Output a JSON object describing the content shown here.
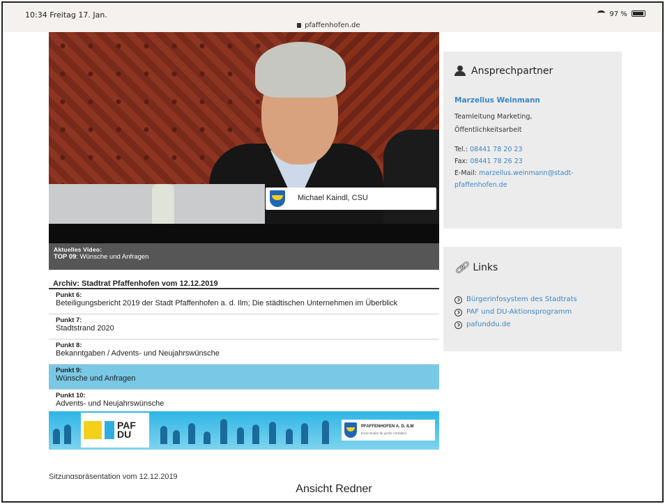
{
  "status_bar": {
    "time": "10:34",
    "date": "Freitag 17. Jan.",
    "url": "pfaffenhofen.de",
    "battery": "97 %"
  },
  "video": {
    "speaker": "Michael Kaindl, CSU",
    "current_label": "Aktuelles Video:",
    "current_top_prefix": "TOP 09",
    "current_top_title": ": Wünsche und Anfragen"
  },
  "archive": {
    "title": "Archiv: Stadtrat Pfaffenhofen vom 12.12.2019",
    "items": [
      {
        "point": "Punkt 6:",
        "text": "Beteiligungsbericht 2019 der Stadt Pfaffenhofen a. d. Ilm; Die städtischen Unternehmen im Überblick",
        "active": false
      },
      {
        "point": "Punkt 7:",
        "text": "Stadtstrand 2020",
        "active": false
      },
      {
        "point": "Punkt 8:",
        "text": "Bekanntgaben / Advents- und Neujahrswünsche",
        "active": false
      },
      {
        "point": "Punkt 9:",
        "text": "Wünsche und Anfragen",
        "active": true
      },
      {
        "point": "Punkt 10:",
        "text": "Advents- und Neujahrswünsche",
        "active": false
      }
    ]
  },
  "banner": {
    "paf_text_1": "PAF",
    "paf_text_2": "DU",
    "logo_title": "PFAFFENHOFEN A. D. ILM",
    "logo_sub": "Eurer Boden für große Vorhaben"
  },
  "cutoff_text": "Sitzungspräsentation vom 12.12.2019",
  "contact": {
    "heading": "Ansprechpartner",
    "name": "Marzellus Weinmann",
    "role_line1": "Teamleitung Marketing,",
    "role_line2": "Öffentlichkeitsarbeit",
    "tel_label": "Tel.:",
    "tel": "08441 78 20 23",
    "fax_label": "Fax:",
    "fax": "08441 78 26 23",
    "email_label": "E-Mail:",
    "email_line1": "marzellus.weinmann@stadt-",
    "email_line2": "pfaffenhofen.de"
  },
  "links": {
    "heading": "Links",
    "items": [
      "Bürgerinfosystem des Stadtrats",
      "PAF und DU-Aktionsprogramm",
      "pafunddu.de"
    ]
  },
  "caption": "Ansicht Redner",
  "colors": {
    "link": "#3a86c6",
    "active_row": "#79c8e5",
    "card_bg": "#ececec"
  }
}
